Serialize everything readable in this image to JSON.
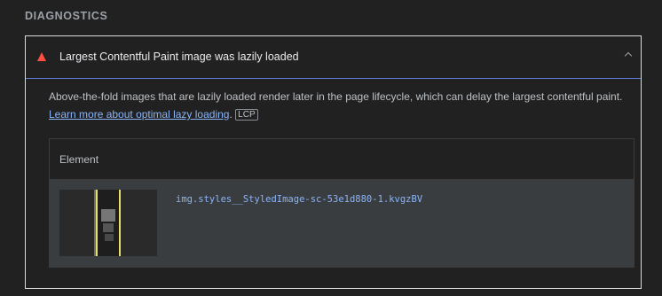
{
  "section": {
    "title": "DIAGNOSTICS"
  },
  "audit": {
    "title": "Largest Contentful Paint image was lazily loaded",
    "status": "fail",
    "description": "Above-the-fold images that are lazily loaded render later in the page lifecycle, which can delay the largest contentful paint.",
    "learn_more_link": "Learn more about optimal lazy loading",
    "after_link": ".",
    "badge": "LCP",
    "colors": {
      "fail": "#ff4e42",
      "link": "#8ab4f8"
    }
  },
  "table": {
    "headers": [
      "Element"
    ],
    "rows": [
      {
        "thumbnail": "element-screenshot",
        "node": "img.styles__StyledImage-sc-53e1d880-1.kvgzBV"
      }
    ]
  }
}
